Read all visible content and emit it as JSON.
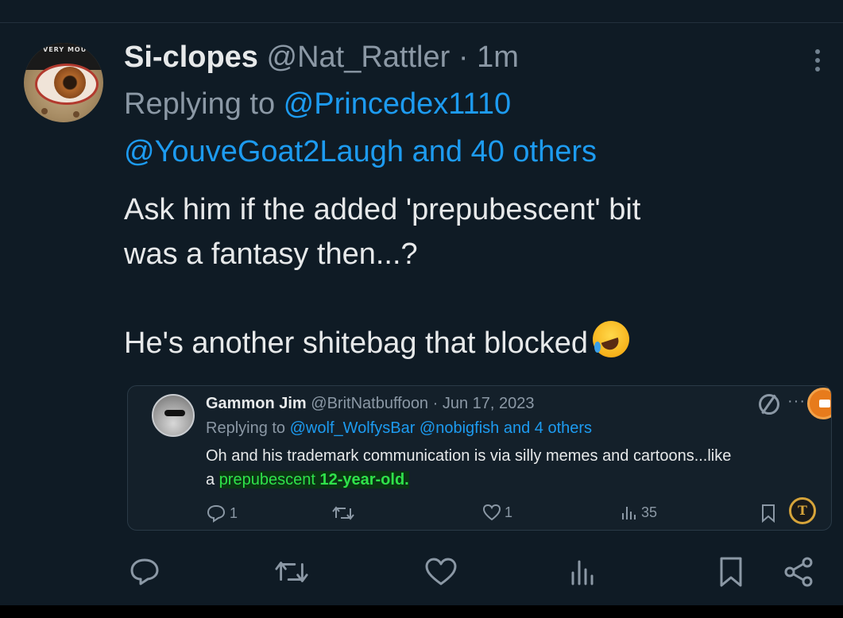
{
  "tweet": {
    "author_name": "Si-clopes",
    "author_handle": "@Nat_Rattler",
    "separator": "·",
    "time": "1m",
    "replying_prefix": "Replying to ",
    "replying_to_1": "@Princedex1110",
    "replying_to_2": "@YouveGoat2Laugh",
    "replying_and": " and ",
    "replying_others": "40 others",
    "text_line_1": "Ask him if the added 'prepubescent' bit",
    "text_line_2": "was a fantasy then...?",
    "text_line_3": "He's another shitebag that blocked",
    "emoji": "rolling-on-floor-laughing-emoji",
    "avatar_cap_text": "VERY MOU"
  },
  "quoted_tweet": {
    "author_name": "Gammon Jim",
    "author_handle": "@BritNatbuffoon",
    "separator": "·",
    "date": "Jun 17, 2023",
    "more": "···",
    "replying_prefix": "Replying to ",
    "replying_to": "@wolf_WolfysBar @nobigfish and 4 others",
    "text_line_1": "Oh and his trademark communication is via silly memes and cartoons...like",
    "text_line_2_a": "a ",
    "text_line_2_b": "prepubescent ",
    "text_line_2_c": "12-year-old.",
    "replies": "1",
    "likes": "1",
    "views": "35",
    "coin_glyph": "T"
  },
  "actions": {
    "reply": "reply-icon",
    "retweet": "retweet-icon",
    "like": "heart-icon",
    "views": "views-icon",
    "bookmark": "bookmark-icon",
    "share": "share-icon"
  },
  "colors": {
    "background": "#0f1b25",
    "accent": "#1d9bf0",
    "muted": "#8b98a5",
    "highlight": "#2fe24a"
  }
}
